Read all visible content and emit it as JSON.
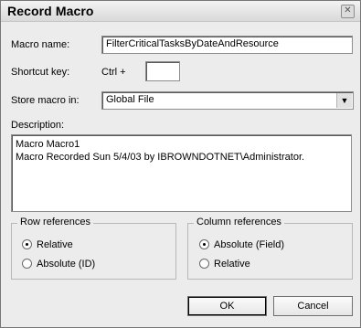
{
  "dialog": {
    "title": "Record Macro"
  },
  "macro_name": {
    "label": "Macro name:",
    "value": "FilterCriticalTasksByDateAndResource"
  },
  "shortcut": {
    "label": "Shortcut key:",
    "prefix": "Ctrl +",
    "value": ""
  },
  "store": {
    "label": "Store macro in:",
    "value": "Global File"
  },
  "description": {
    "label": "Description:",
    "line1": "Macro Macro1",
    "line2": "Macro Recorded Sun 5/4/03 by IBROWNDOTNET\\Administrator."
  },
  "row_refs": {
    "title": "Row references",
    "option1": "Relative",
    "option2": "Absolute (ID)",
    "selected": "Relative"
  },
  "col_refs": {
    "title": "Column references",
    "option1": "Absolute (Field)",
    "option2": "Relative",
    "selected": "Absolute (Field)"
  },
  "buttons": {
    "ok": "OK",
    "cancel": "Cancel"
  }
}
